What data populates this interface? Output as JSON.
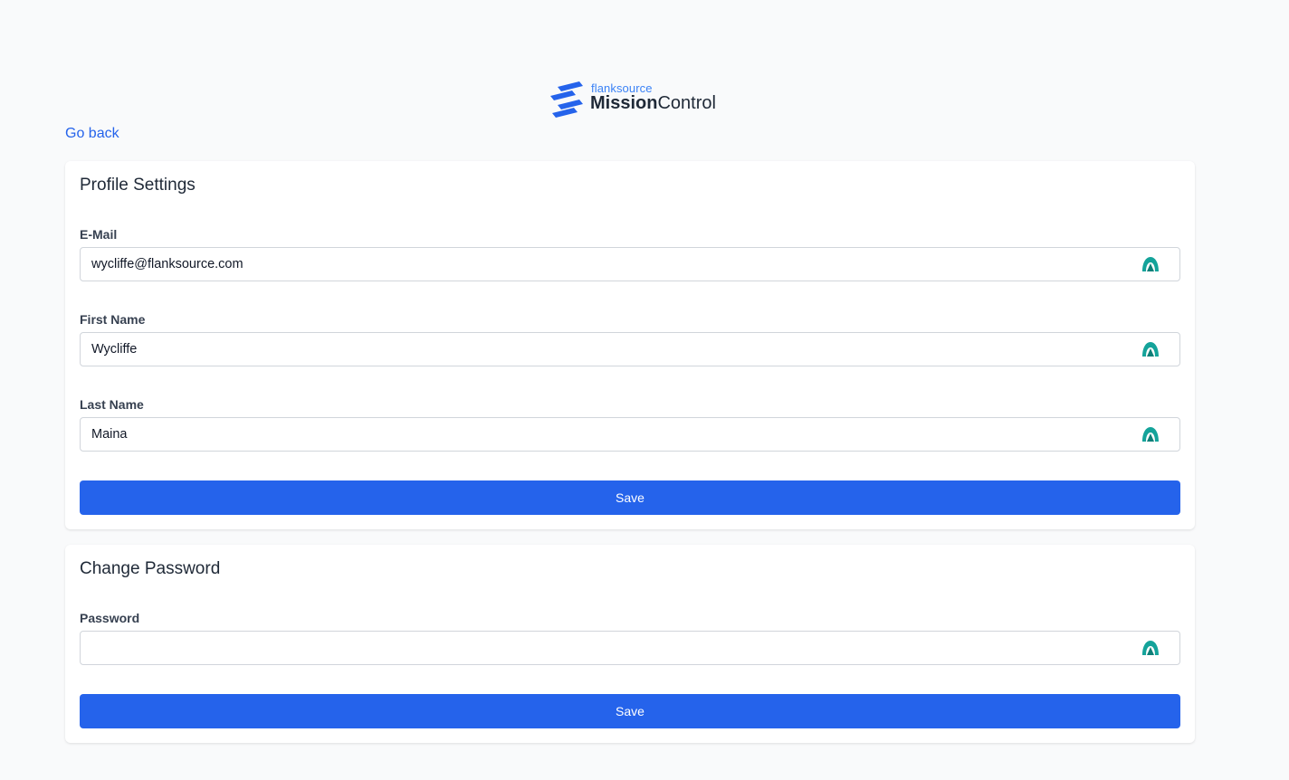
{
  "brand": {
    "small": "flanksource",
    "big_bold": "Mission",
    "big_light": "Control",
    "color": "#2563eb"
  },
  "nav": {
    "go_back": "Go back"
  },
  "profile": {
    "title": "Profile Settings",
    "email": {
      "label": "E-Mail",
      "value": "wycliffe@flanksource.com"
    },
    "first_name": {
      "label": "First Name",
      "value": "Wycliffe"
    },
    "last_name": {
      "label": "Last Name",
      "value": "Maina"
    },
    "save_label": "Save"
  },
  "password": {
    "title": "Change Password",
    "field": {
      "label": "Password",
      "value": ""
    },
    "save_label": "Save"
  },
  "icons": {
    "field_icon": "password-manager-icon",
    "field_icon_color": "#14a39a"
  }
}
